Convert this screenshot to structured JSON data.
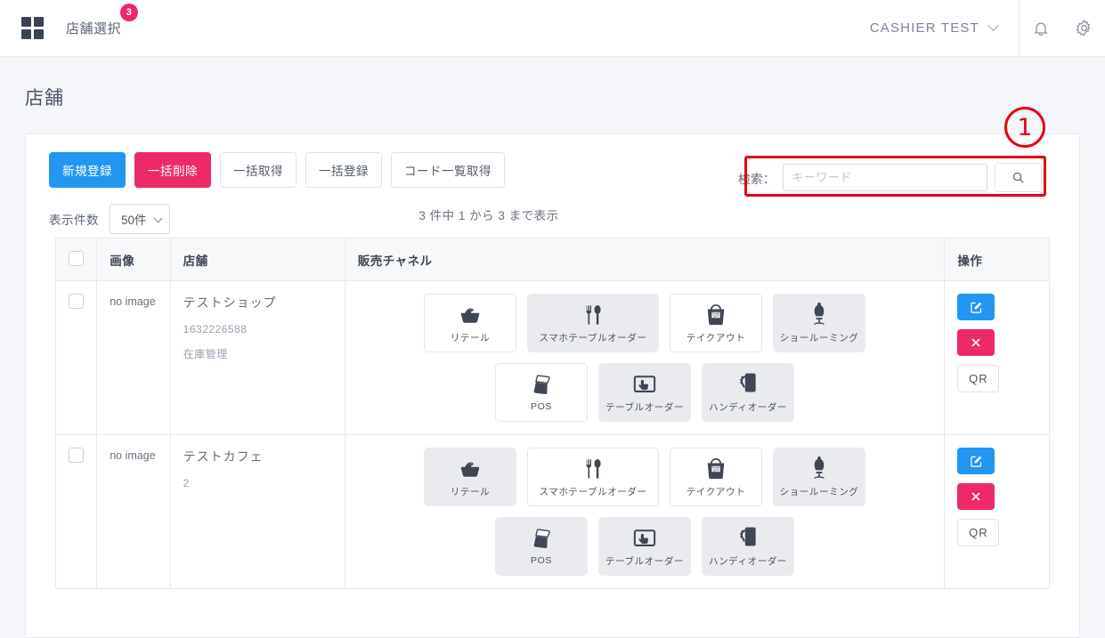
{
  "header": {
    "grid_icon": "grid-icon",
    "store_select_label": "店舗選択",
    "store_select_badge": "3",
    "user_label": "CASHIER  TEST",
    "bell_icon": "bell-icon",
    "gear_icon": "gear-icon"
  },
  "page": {
    "title": "店舗"
  },
  "toolbar": {
    "new_label": "新規登録",
    "bulk_delete_label": "一括削除",
    "bulk_get_label": "一括取得",
    "bulk_register_label": "一括登録",
    "code_list_label": "コード一覧取得"
  },
  "search": {
    "label": "検索：",
    "placeholder": "キーワード",
    "value": "",
    "button_icon": "search-icon"
  },
  "annotation": {
    "marker": "①"
  },
  "meta": {
    "length_label": "表示件数",
    "length_value": "50件",
    "count_info": "3 件中 1 から 3 まで表示"
  },
  "table": {
    "headers": {
      "checkbox": "",
      "image": "画像",
      "store": "店舗",
      "channels": "販売チャネル",
      "operation": "操作"
    },
    "rows": [
      {
        "image_text": "no image",
        "name": "テストショップ",
        "code": "1632226588",
        "note": "在庫管理",
        "channels_row1": [
          {
            "label": "リテール",
            "icon": "basket-icon",
            "active": true,
            "wide": false
          },
          {
            "label": "スマホテーブルオーダー",
            "icon": "cutlery-icon",
            "active": false,
            "wide": true
          },
          {
            "label": "テイクアウト",
            "icon": "takeout-bag-icon",
            "active": true,
            "wide": false
          },
          {
            "label": "ショールーミング",
            "icon": "mannequin-icon",
            "active": false,
            "wide": false
          }
        ],
        "channels_row2": [
          {
            "label": "POS",
            "icon": "pos-terminal-icon",
            "active": true,
            "wide": false
          },
          {
            "label": "テーブルオーダー",
            "icon": "tablet-touch-icon",
            "active": false,
            "wide": false
          },
          {
            "label": "ハンディオーダー",
            "icon": "handy-device-icon",
            "active": false,
            "wide": false
          }
        ],
        "ops": {
          "edit": "edit-icon",
          "delete": "close-icon",
          "qr": "QR"
        }
      },
      {
        "image_text": "no image",
        "name": "テストカフェ",
        "code": "2",
        "note": "",
        "channels_row1": [
          {
            "label": "リテール",
            "icon": "basket-icon",
            "active": false,
            "wide": false
          },
          {
            "label": "スマホテーブルオーダー",
            "icon": "cutlery-icon",
            "active": true,
            "wide": true
          },
          {
            "label": "テイクアウト",
            "icon": "takeout-bag-icon",
            "active": true,
            "wide": false
          },
          {
            "label": "ショールーミング",
            "icon": "mannequin-icon",
            "active": false,
            "wide": false
          }
        ],
        "channels_row2": [
          {
            "label": "POS",
            "icon": "pos-terminal-icon",
            "active": false,
            "wide": false
          },
          {
            "label": "テーブルオーダー",
            "icon": "tablet-touch-icon",
            "active": false,
            "wide": false
          },
          {
            "label": "ハンディオーダー",
            "icon": "handy-device-icon",
            "active": false,
            "wide": false
          }
        ],
        "ops": {
          "edit": "edit-icon",
          "delete": "close-icon",
          "qr": "QR"
        }
      }
    ]
  },
  "colors": {
    "primary": "#2196f3",
    "danger": "#ec2a68",
    "annotation": "#e60012",
    "page_bg": "#f4f6f9"
  }
}
